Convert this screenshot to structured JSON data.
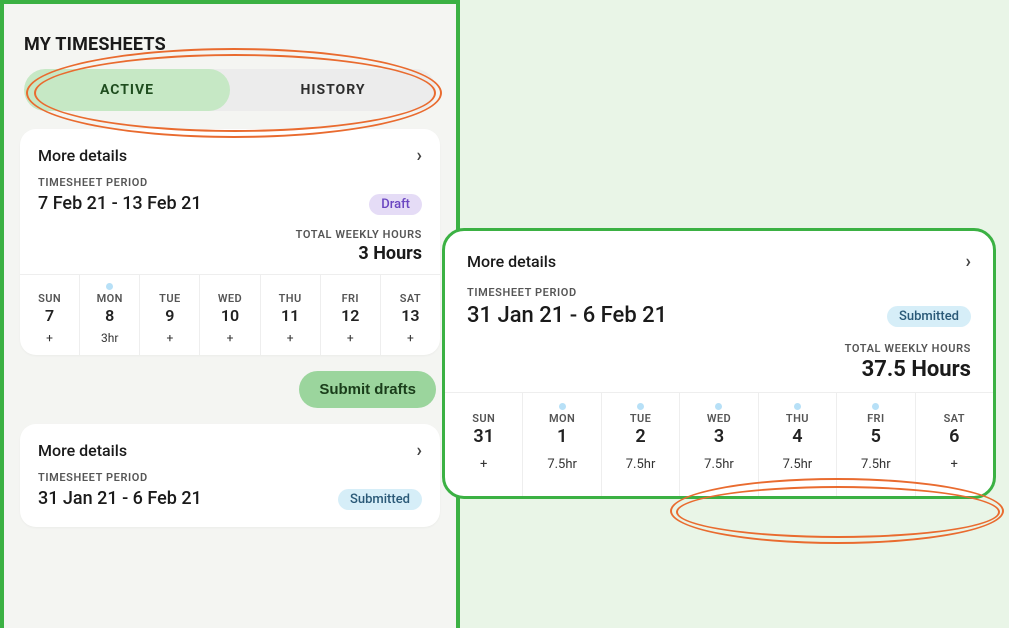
{
  "heading": "MY TIMESHEETS",
  "tabs": {
    "active": "ACTIVE",
    "history": "HISTORY"
  },
  "more": "More details",
  "period_label": "TIMESHEET PERIOD",
  "total_label": "TOTAL WEEKLY HOURS",
  "card1": {
    "range": "7 Feb 21 - 13 Feb 21",
    "status": "Draft",
    "total": "3 Hours",
    "days": [
      {
        "name": "SUN",
        "num": "7",
        "val": "+",
        "dot": false
      },
      {
        "name": "MON",
        "num": "8",
        "val": "3hr",
        "dot": true
      },
      {
        "name": "TUE",
        "num": "9",
        "val": "+",
        "dot": false
      },
      {
        "name": "WED",
        "num": "10",
        "val": "+",
        "dot": false
      },
      {
        "name": "THU",
        "num": "11",
        "val": "+",
        "dot": false
      },
      {
        "name": "FRI",
        "num": "12",
        "val": "+",
        "dot": false
      },
      {
        "name": "SAT",
        "num": "13",
        "val": "+",
        "dot": false
      }
    ]
  },
  "submit_label": "Submit drafts",
  "card2": {
    "range": "31 Jan 21 - 6 Feb 21",
    "status": "Submitted"
  },
  "popup": {
    "range": "31 Jan 21 - 6 Feb 21",
    "status": "Submitted",
    "total": "37.5 Hours",
    "days": [
      {
        "name": "SUN",
        "num": "31",
        "val": "+",
        "dot": false
      },
      {
        "name": "MON",
        "num": "1",
        "val": "7.5hr",
        "dot": true
      },
      {
        "name": "TUE",
        "num": "2",
        "val": "7.5hr",
        "dot": true
      },
      {
        "name": "WED",
        "num": "3",
        "val": "7.5hr",
        "dot": true
      },
      {
        "name": "THU",
        "num": "4",
        "val": "7.5hr",
        "dot": true
      },
      {
        "name": "FRI",
        "num": "5",
        "val": "7.5hr",
        "dot": true
      },
      {
        "name": "SAT",
        "num": "6",
        "val": "+",
        "dot": false
      }
    ]
  }
}
